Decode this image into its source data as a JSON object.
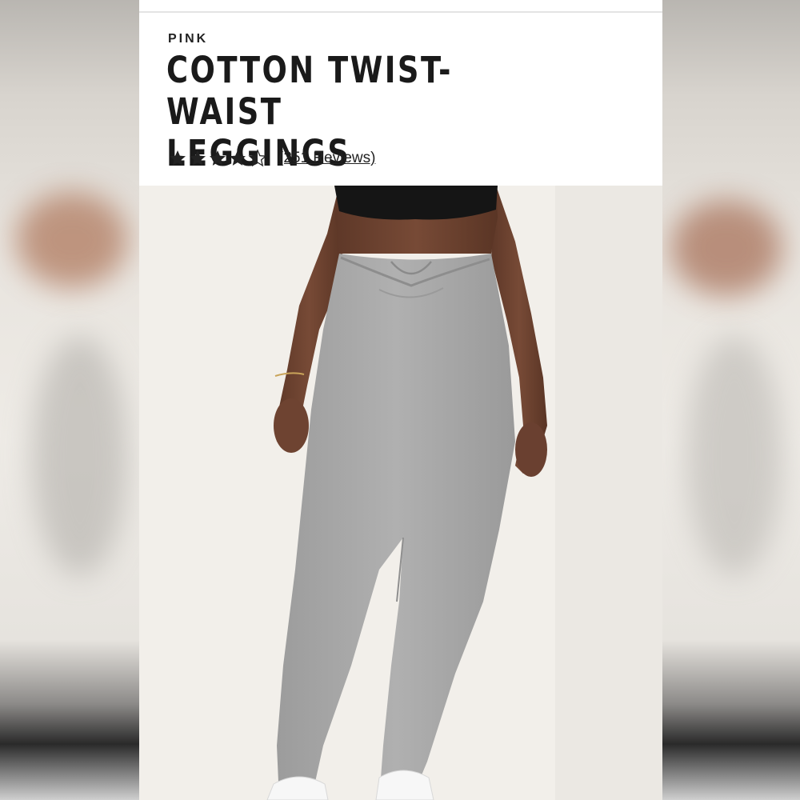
{
  "product": {
    "brand": "PINK",
    "title_line1": "COTTON TWIST-WAIST",
    "title_line2": "LEGGINGS",
    "rating": 4.5,
    "rating_max": 5,
    "reviews_label": "(251 Reviews)"
  },
  "image": {
    "subject": "model-wearing-gray-leggings",
    "colors": {
      "leggings": "#a9a9a9",
      "skin": "#6b4030",
      "top": "#151515",
      "wall": "#f2efea"
    }
  },
  "icons": {
    "star_full": "star-icon",
    "star_half": "half-star-icon"
  }
}
